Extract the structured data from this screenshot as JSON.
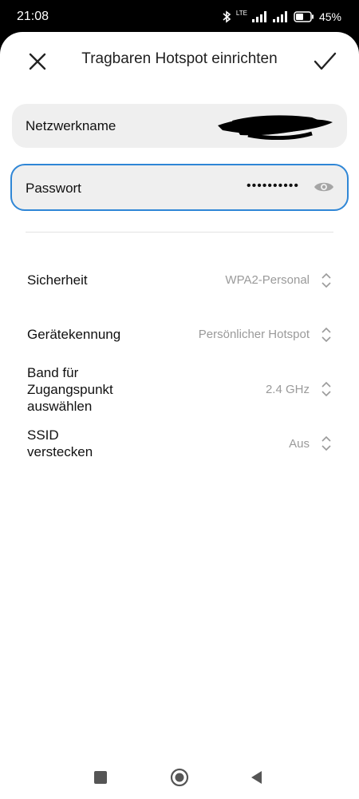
{
  "status_bar": {
    "time": "21:08",
    "network": "LTE",
    "battery": "45%"
  },
  "header": {
    "title": "Tragbaren Hotspot einrichten"
  },
  "fields": {
    "network_name": {
      "label": "Netzwerkname"
    },
    "password": {
      "label": "Passwort",
      "value": "••••••••••"
    }
  },
  "settings": [
    {
      "label": "Sicherheit",
      "value": "WPA2-Personal"
    },
    {
      "label": "Gerätekennung",
      "value": "Persönlicher Hotspot"
    },
    {
      "label_lines": [
        "Band für",
        "Zugangspunkt",
        "auswählen"
      ],
      "value": "2.4 GHz"
    },
    {
      "label_lines": [
        "SSID",
        "verstecken"
      ],
      "value": "Aus"
    }
  ],
  "colors": {
    "accent": "#2f86d6",
    "field_bg": "#efefef",
    "value_text": "#9a9a9a"
  }
}
